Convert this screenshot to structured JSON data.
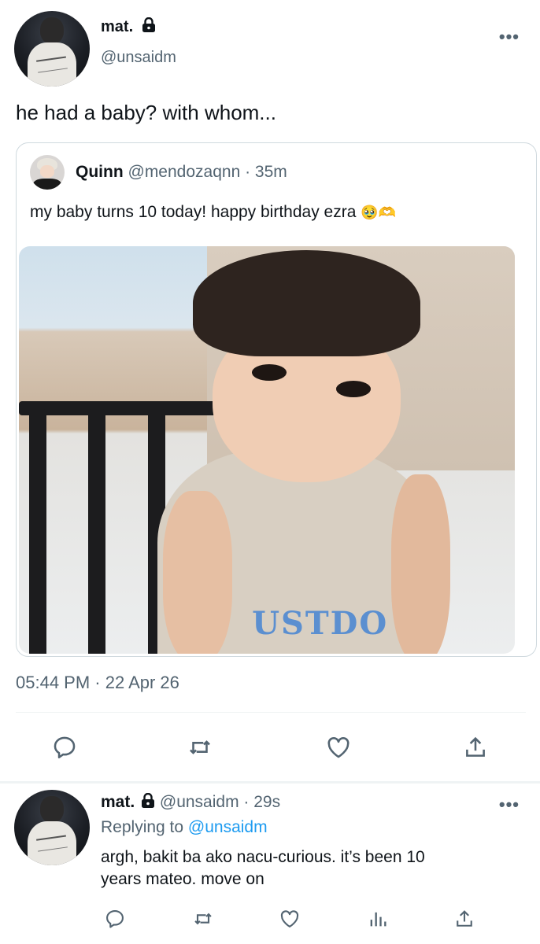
{
  "main_tweet": {
    "author_name": "mat.",
    "author_handle": "@unsaidm",
    "text": "he had a baby? with whom...",
    "timestamp": "05:44 PM · 22 Apr 26",
    "more_label": "•••",
    "quoted": {
      "author_name": "Quinn",
      "author_handle": "@mendozaqnn",
      "time": "· 35m",
      "text": "my baby turns 10 today! happy birthday ezra",
      "emoji": "🥹🫶"
    },
    "photo_shirt_text": "USTDO"
  },
  "reply_tweet": {
    "author_name": "mat.",
    "author_handle": "@unsaidm",
    "time": "· 29s",
    "replying_to_label": "Replying to",
    "replying_to_handle": "@unsaidm",
    "text_line1": "argh, bakit ba ako nacu-curious. it’s been 10",
    "text_line2": "years mateo. move on",
    "more_label": "•••"
  },
  "colors": {
    "text": "#0f1419",
    "secondary": "#536471",
    "link": "#1d9bf0",
    "border": "#cfd9de"
  },
  "icons": {
    "reply": "reply-icon",
    "retweet": "retweet-icon",
    "like": "heart-icon",
    "share": "share-icon",
    "views": "views-icon",
    "lock": "lock-icon"
  }
}
